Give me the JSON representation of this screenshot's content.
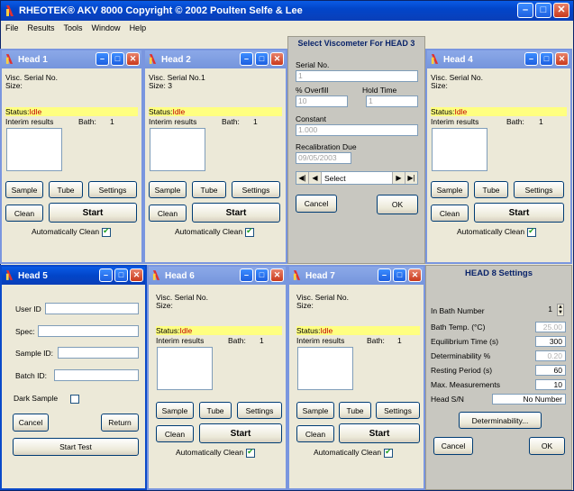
{
  "app": {
    "title": "RHEOTEK® AKV 8000  Copyright © 2002 Poulten Selfe & Lee",
    "menu": [
      "File",
      "Results",
      "Tools",
      "Window",
      "Help"
    ]
  },
  "heads": {
    "h1": {
      "title": "Head 1",
      "serial": "Visc. Serial No.",
      "size": "Size:",
      "status_label": "Status:",
      "status": "Idle",
      "interim": "Interim results",
      "bath": "Bath:",
      "bath_no": "1"
    },
    "h2": {
      "title": "Head 2",
      "serial": "Visc. Serial No.1",
      "size": "Size:  3",
      "status_label": "Status:",
      "status": "Idle",
      "interim": "Interim results",
      "bath": "Bath:",
      "bath_no": "1"
    },
    "h4": {
      "title": "Head 4",
      "serial": "Visc. Serial No.",
      "size": "Size:",
      "status_label": "Status:",
      "status": "Idle",
      "interim": "Interim results",
      "bath": "Bath:",
      "bath_no": "1"
    },
    "h6": {
      "title": "Head 6",
      "serial": "Visc. Serial No.",
      "size": "Size:",
      "status_label": "Status:",
      "status": "Idle",
      "interim": "Interim results",
      "bath": "Bath:",
      "bath_no": "1"
    },
    "h7": {
      "title": "Head 7",
      "serial": "Visc. Serial No.",
      "size": "Size:",
      "status_label": "Status:",
      "status": "Idle",
      "interim": "Interim results",
      "bath": "Bath:",
      "bath_no": "1"
    }
  },
  "buttons": {
    "sample": "Sample",
    "tube": "Tube",
    "settings": "Settings",
    "clean": "Clean",
    "start": "Start",
    "auto_clean": "Automatically Clean"
  },
  "head5": {
    "title": "Head 5",
    "user_id": "User ID",
    "spec": "Spec:",
    "sample_id": "Sample ID:",
    "batch_id": "Batch ID:",
    "dark_sample": "Dark Sample",
    "cancel": "Cancel",
    "return": "Return",
    "start_test": "Start Test"
  },
  "viscometer": {
    "title": "Select Viscometer For HEAD 3",
    "serial_label": "Serial No.",
    "serial_value": "1",
    "overfill_label": "% Overfill",
    "overfill_value": "10",
    "hold_label": "Hold Time",
    "hold_value": "1",
    "constant_label": "Constant",
    "constant_value": "1.000",
    "recal_label": "Recalibration Due",
    "recal_value": "09/05/2003",
    "nav_select": "Select",
    "cancel": "Cancel",
    "ok": "OK"
  },
  "settings": {
    "title": "HEAD 8 Settings",
    "bath_number_label": "In Bath Number",
    "bath_number": "1",
    "bath_temp_label": "Bath Temp. (°C)",
    "bath_temp": "25.00",
    "equil_label": "Equilibrium Time (s)",
    "equil": "300",
    "determ_label": "Determinability %",
    "determ": "0.20",
    "rest_label": "Resting Period (s)",
    "rest": "60",
    "maxmeas_label": "Max. Measurements",
    "maxmeas": "10",
    "sn_label": "Head S/N",
    "sn": "No Number",
    "determ_btn": "Determinability...",
    "cancel": "Cancel",
    "ok": "OK"
  },
  "colors": {
    "accent": "#0245c9",
    "status_bg": "#ffff80",
    "status_text": "#c00000"
  }
}
